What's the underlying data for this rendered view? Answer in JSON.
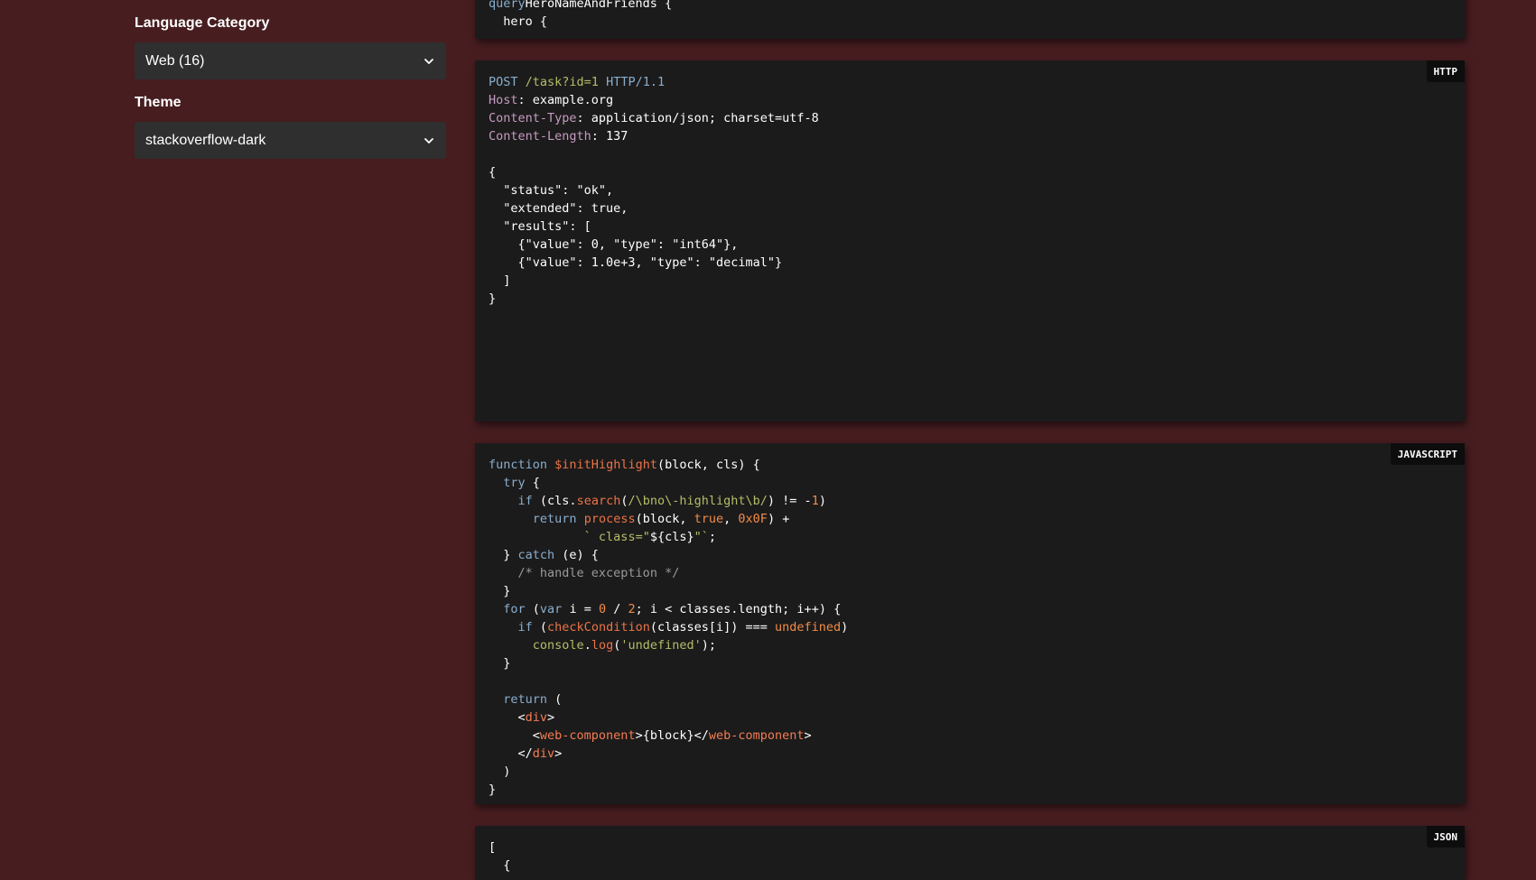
{
  "sidebar": {
    "language_category": {
      "label": "Language Category",
      "value": "Web (16)"
    },
    "theme": {
      "label": "Theme",
      "value": "stackoverflow-dark"
    }
  },
  "code_blocks": [
    {
      "language": "GraphQL",
      "badge": "",
      "lines": [
        [
          [
            "k",
            "query"
          ],
          [
            "",
            "HeroNameAndFriends {"
          ]
        ],
        [
          [
            "",
            "  hero {"
          ]
        ]
      ]
    },
    {
      "language": "HTTP",
      "badge": "HTTP",
      "lines": [
        [
          [
            "k",
            "POST"
          ],
          [
            "",
            " "
          ],
          [
            "s",
            "/task?id=1"
          ],
          [
            "",
            " "
          ],
          [
            "k",
            "HTTP/1.1"
          ]
        ],
        [
          [
            "a",
            "Host"
          ],
          [
            "",
            ": example.org"
          ]
        ],
        [
          [
            "a",
            "Content-Type"
          ],
          [
            "",
            ": application/json; charset=utf-8"
          ]
        ],
        [
          [
            "a",
            "Content-Length"
          ],
          [
            "",
            ": 137"
          ]
        ],
        [
          [
            "",
            ""
          ]
        ],
        [
          [
            "",
            "{"
          ]
        ],
        [
          [
            "",
            "  \"status\": \"ok\","
          ]
        ],
        [
          [
            "",
            "  \"extended\": true,"
          ]
        ],
        [
          [
            "",
            "  \"results\": ["
          ]
        ],
        [
          [
            "",
            "    {\"value\": 0, \"type\": \"int64\"},"
          ]
        ],
        [
          [
            "",
            "    {\"value\": 1.0e+3, \"type\": \"decimal\"}"
          ]
        ],
        [
          [
            "",
            "  ]"
          ]
        ],
        [
          [
            "",
            "}"
          ]
        ]
      ]
    },
    {
      "language": "JavaScript",
      "badge": "JAVASCRIPT",
      "lines": [
        [
          [
            "k",
            "function"
          ],
          [
            "",
            " "
          ],
          [
            "f",
            "$initHighlight"
          ],
          [
            "",
            "(block, cls) {"
          ]
        ],
        [
          [
            "",
            "  "
          ],
          [
            "k",
            "try"
          ],
          [
            "",
            " {"
          ]
        ],
        [
          [
            "",
            "    "
          ],
          [
            "k",
            "if"
          ],
          [
            "",
            " (cls."
          ],
          [
            "f",
            "search"
          ],
          [
            "",
            "("
          ],
          [
            "s",
            "/\\bno\\-highlight\\b/"
          ],
          [
            "",
            ") != -"
          ],
          [
            "b",
            "1"
          ],
          [
            "",
            ")"
          ]
        ],
        [
          [
            "",
            "      "
          ],
          [
            "k",
            "return"
          ],
          [
            "",
            " "
          ],
          [
            "f",
            "process"
          ],
          [
            "",
            "(block, "
          ],
          [
            "b",
            "true"
          ],
          [
            "",
            ", "
          ],
          [
            "b",
            "0x0F"
          ],
          [
            "",
            ") +"
          ]
        ],
        [
          [
            "",
            "             "
          ],
          [
            "s",
            "` class=\""
          ],
          [
            "",
            "${cls}"
          ],
          [
            "s",
            "\"`"
          ],
          [
            "",
            ";"
          ]
        ],
        [
          [
            "",
            "  } "
          ],
          [
            "k",
            "catch"
          ],
          [
            "",
            " (e) {"
          ]
        ],
        [
          [
            "",
            "    "
          ],
          [
            "c",
            "/* handle exception */"
          ]
        ],
        [
          [
            "",
            "  }"
          ]
        ],
        [
          [
            "",
            "  "
          ],
          [
            "k",
            "for"
          ],
          [
            "",
            " ("
          ],
          [
            "k",
            "var"
          ],
          [
            "",
            " i = "
          ],
          [
            "b",
            "0"
          ],
          [
            "",
            " / "
          ],
          [
            "b",
            "2"
          ],
          [
            "",
            "; i < classes.length; i++) {"
          ]
        ],
        [
          [
            "",
            "    "
          ],
          [
            "k",
            "if"
          ],
          [
            "",
            " ("
          ],
          [
            "f",
            "checkCondition"
          ],
          [
            "",
            "(classes[i]) === "
          ],
          [
            "b",
            "undefined"
          ],
          [
            "",
            ")"
          ]
        ],
        [
          [
            "",
            "      "
          ],
          [
            "s",
            "console"
          ],
          [
            "",
            "."
          ],
          [
            "f",
            "log"
          ],
          [
            "",
            "("
          ],
          [
            "s",
            "'undefined'"
          ],
          [
            "",
            ");"
          ]
        ],
        [
          [
            "",
            "  }"
          ]
        ],
        [
          [
            "",
            ""
          ]
        ],
        [
          [
            "",
            "  "
          ],
          [
            "k",
            "return"
          ],
          [
            "",
            " ("
          ]
        ],
        [
          [
            "",
            "    <"
          ],
          [
            "t",
            "div"
          ],
          [
            "",
            ">"
          ]
        ],
        [
          [
            "",
            "      <"
          ],
          [
            "t",
            "web-component"
          ],
          [
            "",
            ">{block}</"
          ],
          [
            "t",
            "web-component"
          ],
          [
            "",
            ">"
          ]
        ],
        [
          [
            "",
            "    </"
          ],
          [
            "t",
            "div"
          ],
          [
            "",
            ">"
          ]
        ],
        [
          [
            "",
            "  )"
          ]
        ],
        [
          [
            "",
            "}"
          ]
        ]
      ]
    },
    {
      "language": "JSON",
      "badge": "JSON",
      "lines": [
        [
          [
            "",
            "["
          ]
        ],
        [
          [
            "",
            "  {"
          ]
        ]
      ]
    }
  ],
  "colors": {
    "background": "#471d20",
    "code_background": "#1c1b1b",
    "select_background": "#2f2f2f",
    "keyword": "#88aece",
    "string": "#b5bd68",
    "function": "#ea7447",
    "attribute": "#c59bc1",
    "literal": "#f08d49",
    "comment": "#999999"
  },
  "icons": {
    "select_chevron": "chevron-down-icon"
  }
}
